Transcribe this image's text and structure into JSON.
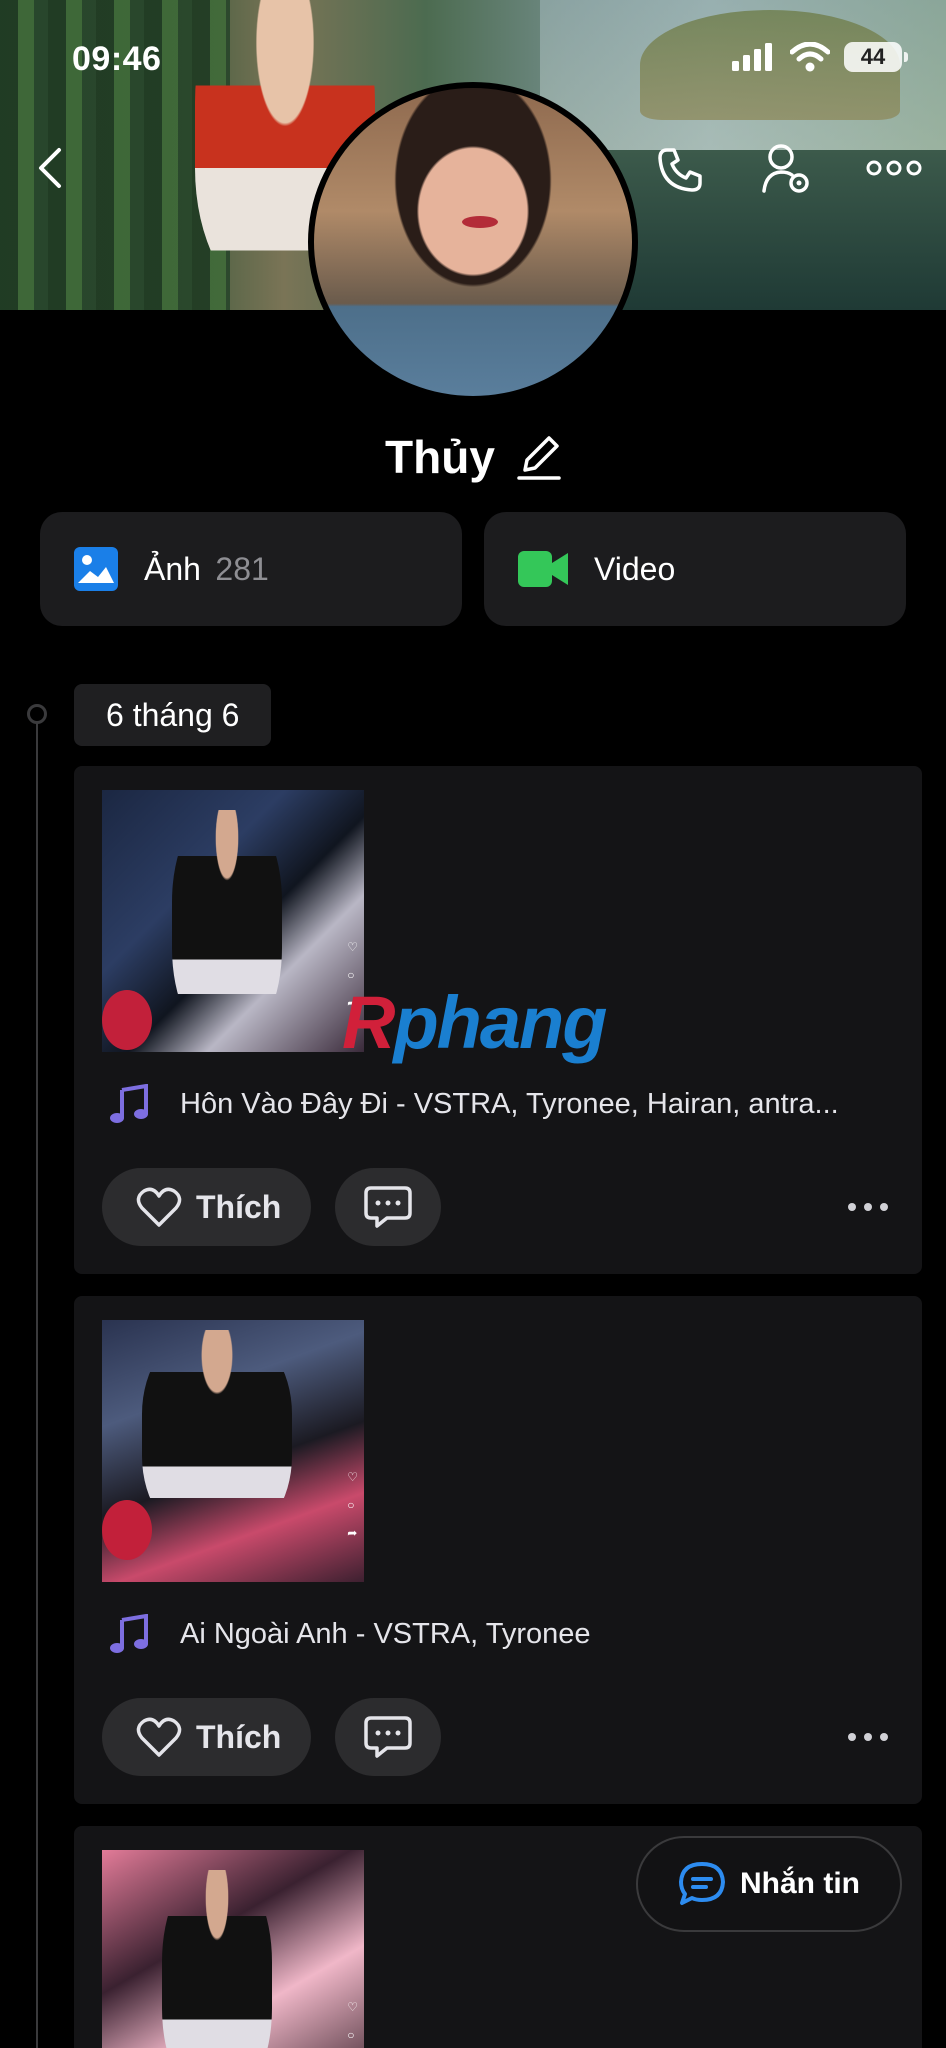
{
  "status_bar": {
    "time": "09:46",
    "battery": "44"
  },
  "profile": {
    "name": "Thủy"
  },
  "media": {
    "photos_label": "Ảnh",
    "photos_count": "281",
    "videos_label": "Video"
  },
  "timeline": {
    "date": "6 tháng 6",
    "posts": [
      {
        "song": "Hôn Vào Đây Đi - VSTRA, Tyronee, Hairan, antra...",
        "like_label": "Thích"
      },
      {
        "song": "Ai Ngoài Anh - VSTRA, Tyronee",
        "like_label": "Thích"
      }
    ]
  },
  "watermark": {
    "r": "R",
    "rest": "phang"
  },
  "message_button": {
    "label": "Nhắn tin"
  },
  "colors": {
    "background": "#000000",
    "card": "#141416",
    "photo_icon": "#1a7fe8",
    "video_icon": "#34c759",
    "music_icon": "#7d6ee0",
    "message_icon": "#2d8cf0"
  },
  "icons": [
    "back-icon",
    "phone-icon",
    "user-settings-icon",
    "more-icon",
    "pencil-icon",
    "photo-icon",
    "video-camera-icon",
    "music-note-icon",
    "heart-icon",
    "comment-icon",
    "chat-icon"
  ]
}
